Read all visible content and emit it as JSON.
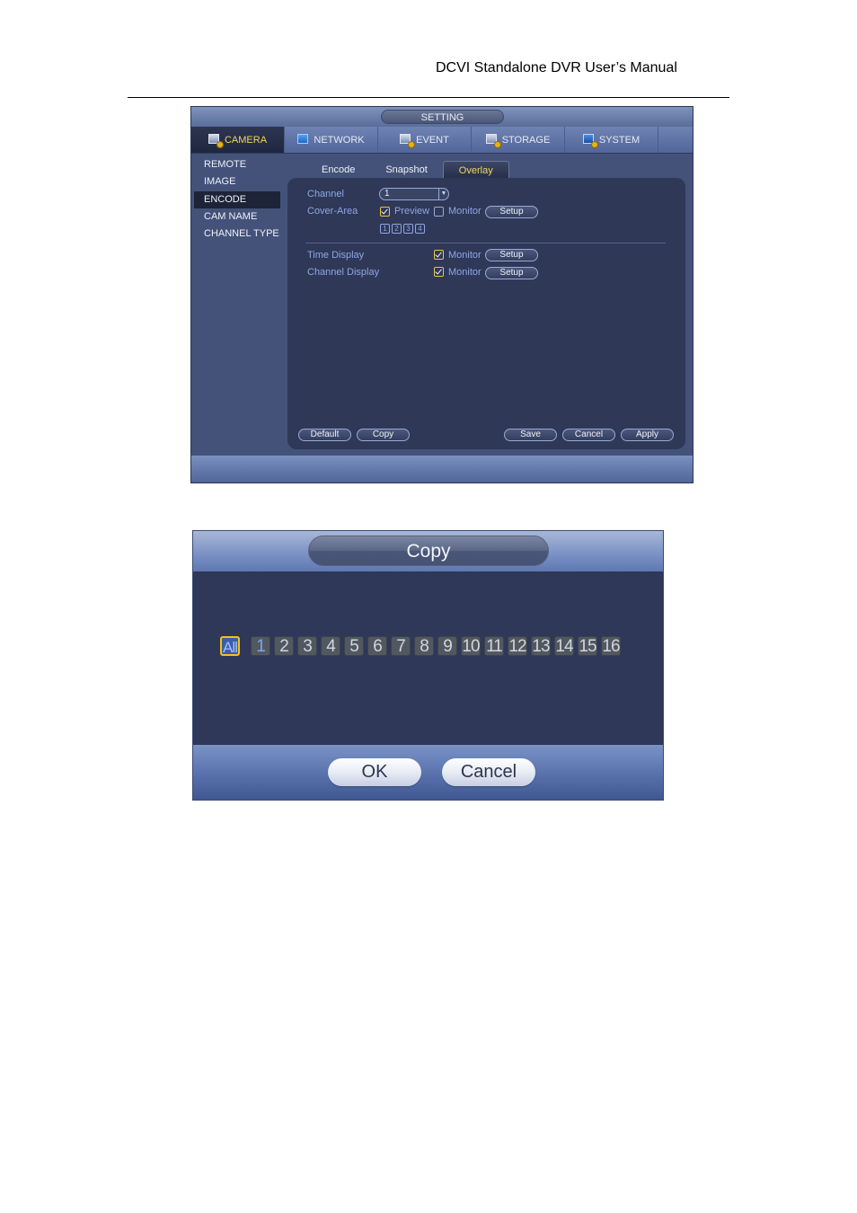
{
  "doc": {
    "header": "DCVI Standalone DVR User’s Manual"
  },
  "setting_window": {
    "title": "SETTING",
    "top_nav": [
      {
        "label": "CAMERA",
        "icon": "camera-gear-icon",
        "active": true
      },
      {
        "label": "NETWORK",
        "icon": "network-icon",
        "active": false
      },
      {
        "label": "EVENT",
        "icon": "event-gear-icon",
        "active": false
      },
      {
        "label": "STORAGE",
        "icon": "storage-gear-icon",
        "active": false
      },
      {
        "label": "SYSTEM",
        "icon": "system-monitor-gear-icon",
        "active": false
      }
    ],
    "sidebar": [
      {
        "label": "REMOTE",
        "active": false
      },
      {
        "label": "IMAGE",
        "active": false
      },
      {
        "label": "ENCODE",
        "active": true
      },
      {
        "label": "CAM NAME",
        "active": false
      },
      {
        "label": "CHANNEL TYPE",
        "active": false
      }
    ],
    "tabs": [
      {
        "label": "Encode",
        "active": false
      },
      {
        "label": "Snapshot",
        "active": false
      },
      {
        "label": "Overlay",
        "active": true
      }
    ],
    "overlay": {
      "channel_label": "Channel",
      "channel_value": "1",
      "cover_area_label": "Cover-Area",
      "preview_label": "Preview",
      "preview_checked": true,
      "cover_monitor_label": "Monitor",
      "cover_monitor_checked": false,
      "setup_label": "Setup",
      "regions": [
        "1",
        "2",
        "3",
        "4"
      ],
      "time_display_label": "Time Display",
      "time_monitor_label": "Monitor",
      "time_monitor_checked": true,
      "channel_display_label": "Channel Display",
      "channel_monitor_label": "Monitor",
      "channel_monitor_checked": true
    },
    "buttons": {
      "default": "Default",
      "copy": "Copy",
      "save": "Save",
      "cancel": "Cancel",
      "apply": "Apply"
    }
  },
  "copy_dialog": {
    "title": "Copy",
    "all_label": "All",
    "all_selected": true,
    "channels": [
      "1",
      "2",
      "3",
      "4",
      "5",
      "6",
      "7",
      "8",
      "9",
      "10",
      "11",
      "12",
      "13",
      "14",
      "15",
      "16"
    ],
    "current_channel": "1",
    "ok_label": "OK",
    "cancel_label": "Cancel"
  }
}
